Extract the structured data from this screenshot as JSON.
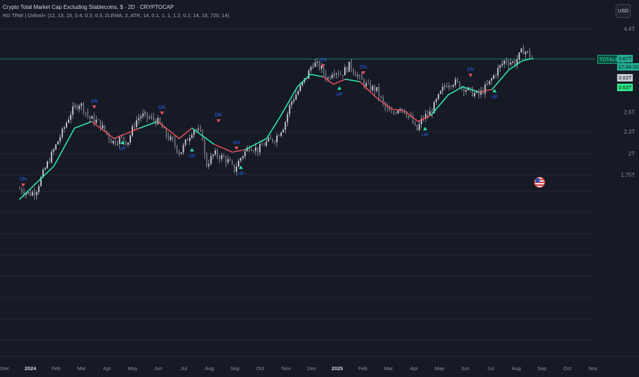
{
  "header": {
    "title": "Crypto Total Market Cap Excluding Stablecoins, $ · 2D · CRYPTOCAP",
    "indicator": "RG TRW | Oxford+ (12, 13, 15, 0.4, 0.3, 0.3, ZLEMA, 2, ATR, 14, 0.1, 1, 1, 1.2, 0.2, 14, 15, 720, 14)"
  },
  "currency_button": "USD",
  "price_tags": {
    "symbol": "TOTALES",
    "last_price": "3.67T",
    "countdown": "17:34:15",
    "gray_value": "3.63T",
    "green_value": "3.63T"
  },
  "colors": {
    "background": "#161a25",
    "grid": "#2a2e39",
    "candle": "#d1d4dc",
    "ma_up": "#2ee6a8",
    "ma_down": "#e0505e",
    "signal_up": "#2ee6a8",
    "signal_down": "#e0505e",
    "signal_text": "#2962ff",
    "price_line": "#1ea37a"
  },
  "chart_data": {
    "type": "line",
    "title": "Crypto Total Market Cap Excluding Stablecoins, $ · 2D · CRYPTOCAP",
    "xlabel": "",
    "ylabel": "",
    "x_ticks": [
      "Dec",
      "2024",
      "Feb",
      "Mar",
      "Apr",
      "May",
      "Jun",
      "Jul",
      "Aug",
      "Sep",
      "Oct",
      "Nov",
      "Dec",
      "2025",
      "Feb",
      "Mar",
      "Apr",
      "May",
      "Jun",
      "Jul",
      "Aug",
      "Sep",
      "Oct",
      "Nov"
    ],
    "y_ticks": [
      "4.4T",
      "2.6T",
      "2.3T",
      "2T",
      "1.75T"
    ],
    "y_tick_values": [
      4.4,
      2.6,
      2.3,
      2.0,
      1.75
    ],
    "x_range": [
      "2023-12-01",
      "2025-11-20"
    ],
    "y_scale": "log",
    "grid": true,
    "current_price": 3.67,
    "series": [
      {
        "kind": "candles",
        "x": [
          "2024-01-01",
          "2024-01-12",
          "2024-01-20",
          "2024-02-01",
          "2024-02-10",
          "2024-02-20",
          "2024-03-01",
          "2024-03-10",
          "2024-03-14",
          "2024-03-22",
          "2024-04-01",
          "2024-04-10",
          "2024-04-18",
          "2024-04-28",
          "2024-05-06",
          "2024-05-15",
          "2024-05-22",
          "2024-06-01",
          "2024-06-10",
          "2024-06-20",
          "2024-07-01",
          "2024-07-06",
          "2024-07-15",
          "2024-07-22",
          "2024-08-01",
          "2024-08-05",
          "2024-08-15",
          "2024-08-25",
          "2024-09-01",
          "2024-09-07",
          "2024-09-15",
          "2024-09-25",
          "2024-10-05",
          "2024-10-15",
          "2024-10-25",
          "2024-11-05",
          "2024-11-12",
          "2024-11-22",
          "2024-12-01",
          "2024-12-08",
          "2024-12-17",
          "2024-12-25",
          "2025-01-01",
          "2025-01-10",
          "2025-01-20",
          "2025-02-01",
          "2025-02-10",
          "2025-02-20",
          "2025-03-01",
          "2025-03-10",
          "2025-03-20",
          "2025-04-01",
          "2025-04-08",
          "2025-04-15",
          "2025-04-25",
          "2025-05-05",
          "2025-05-12",
          "2025-05-22",
          "2025-06-01",
          "2025-06-10",
          "2025-06-20",
          "2025-07-01",
          "2025-07-10",
          "2025-07-20",
          "2025-08-01",
          "2025-08-10",
          "2025-08-14",
          "2025-08-22"
        ],
        "values": [
          1.6,
          1.55,
          1.58,
          1.85,
          2.05,
          2.3,
          2.6,
          2.75,
          2.7,
          2.5,
          2.45,
          2.3,
          2.15,
          2.2,
          2.15,
          2.45,
          2.55,
          2.5,
          2.45,
          2.25,
          2.1,
          2.0,
          2.2,
          2.35,
          2.25,
          1.85,
          2.0,
          1.95,
          1.9,
          1.8,
          1.95,
          2.1,
          2.05,
          2.15,
          2.2,
          2.4,
          2.75,
          3.0,
          3.25,
          3.55,
          3.45,
          3.2,
          3.4,
          3.3,
          3.5,
          3.2,
          3.05,
          3.0,
          2.7,
          2.55,
          2.7,
          2.5,
          2.3,
          2.5,
          2.6,
          2.9,
          3.1,
          3.15,
          3.05,
          2.95,
          2.9,
          3.1,
          3.35,
          3.6,
          3.55,
          3.85,
          3.8,
          3.67
        ]
      },
      {
        "name": "RG TRW | Oxford+",
        "kind": "ma",
        "x": [
          "2024-01-01",
          "2024-02-10",
          "2024-03-05",
          "2024-03-25",
          "2024-04-20",
          "2024-05-20",
          "2024-06-10",
          "2024-07-05",
          "2024-07-20",
          "2024-08-15",
          "2024-09-05",
          "2024-09-20",
          "2024-10-15",
          "2024-11-01",
          "2024-11-20",
          "2024-12-05",
          "2024-12-20",
          "2025-01-01",
          "2025-01-15",
          "2025-02-01",
          "2025-02-20",
          "2025-03-10",
          "2025-03-25",
          "2025-04-10",
          "2025-04-25",
          "2025-05-15",
          "2025-06-01",
          "2025-06-20",
          "2025-07-05",
          "2025-07-25",
          "2025-08-10",
          "2025-08-22"
        ],
        "values": [
          1.5,
          1.85,
          2.35,
          2.45,
          2.2,
          2.35,
          2.45,
          2.2,
          2.35,
          2.12,
          2.02,
          2.05,
          2.2,
          2.55,
          3.05,
          3.3,
          3.25,
          3.1,
          3.2,
          3.15,
          2.85,
          2.65,
          2.62,
          2.45,
          2.55,
          2.9,
          3.05,
          2.95,
          3.0,
          3.4,
          3.6,
          3.65
        ],
        "trend": [
          "up",
          "up",
          "up",
          "down",
          "down",
          "up",
          "down",
          "down",
          "up",
          "down",
          "down",
          "up",
          "up",
          "up",
          "up",
          "up",
          "down",
          "down",
          "up",
          "down",
          "down",
          "down",
          "down",
          "down",
          "up",
          "up",
          "up",
          "down",
          "up",
          "up",
          "up",
          "up"
        ]
      }
    ],
    "signals": [
      {
        "label": "DN",
        "x": "2024-01-05",
        "price": 1.6
      },
      {
        "label": "DN",
        "x": "2024-03-28",
        "price": 2.62
      },
      {
        "label": "UP",
        "x": "2024-04-30",
        "price": 2.2
      },
      {
        "label": "DN",
        "x": "2024-06-15",
        "price": 2.52
      },
      {
        "label": "UP",
        "x": "2024-07-20",
        "price": 2.1
      },
      {
        "label": "DN",
        "x": "2024-08-20",
        "price": 2.4
      },
      {
        "label": "DN",
        "x": "2024-09-10",
        "price": 2.02
      },
      {
        "label": "UP",
        "x": "2024-09-15",
        "price": 1.88
      },
      {
        "label": "DN",
        "x": "2024-12-20",
        "price": 3.4
      },
      {
        "label": "UP",
        "x": "2025-01-08",
        "price": 3.1
      },
      {
        "label": "DN",
        "x": "2025-02-05",
        "price": 3.25
      },
      {
        "label": "UP",
        "x": "2025-04-18",
        "price": 2.4
      },
      {
        "label": "DN",
        "x": "2025-06-10",
        "price": 3.2
      },
      {
        "label": "UP",
        "x": "2025-07-08",
        "price": 3.05
      }
    ]
  }
}
